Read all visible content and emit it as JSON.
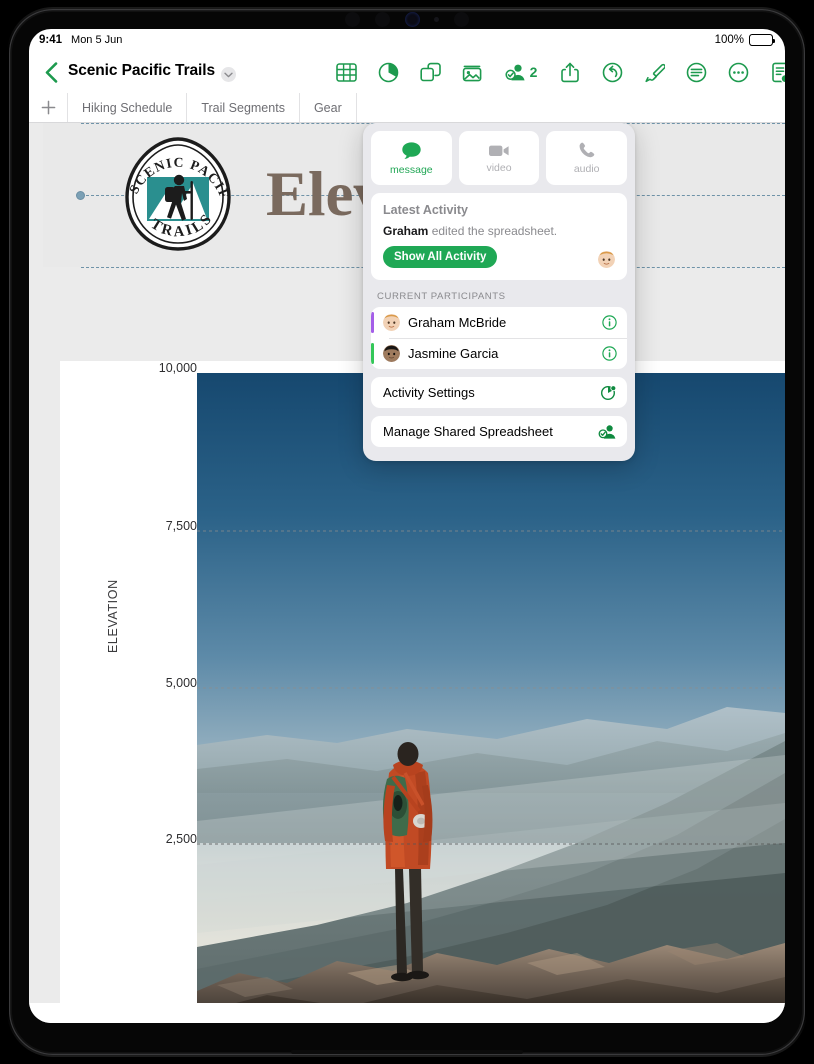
{
  "status_bar": {
    "time": "9:41",
    "date": "Mon 5 Jun",
    "battery_percent": "100%"
  },
  "navbar": {
    "back_icon": "chevron-left-icon",
    "document_title": "Scenic Pacific Trails",
    "title_chevron_icon": "chevron-down-icon",
    "tools": [
      {
        "name": "insert-table",
        "icon": "table-icon"
      },
      {
        "name": "insert-chart",
        "icon": "pie-chart-icon"
      },
      {
        "name": "insert-shape",
        "icon": "shapes-icon"
      },
      {
        "name": "insert-media",
        "icon": "photo-icon"
      },
      {
        "name": "collaborate",
        "icon": "collaborate-person-icon",
        "badge": "2"
      },
      {
        "name": "share",
        "icon": "share-up-arrow-icon"
      },
      {
        "name": "undo",
        "icon": "undo-arrow-icon"
      },
      {
        "name": "format",
        "icon": "paintbrush-icon"
      },
      {
        "name": "document-options",
        "icon": "lines-circle-icon"
      },
      {
        "name": "more",
        "icon": "ellipsis-circle-icon"
      },
      {
        "name": "document-collaboration",
        "icon": "document-badge-icon"
      }
    ]
  },
  "sheet_tabs": {
    "add_icon": "plus-icon",
    "tabs": [
      {
        "label": "Hiking Schedule"
      },
      {
        "label": "Trail Segments"
      },
      {
        "label": "Gear"
      }
    ]
  },
  "sheet": {
    "logo": {
      "top_arc_left": "SCENIC",
      "top_arc_right": "PACIFIC",
      "bottom_text": "TRAILS",
      "badge_color": "#2a8f8f"
    },
    "heading": "Elev",
    "selection_handle": "resize-handle"
  },
  "chart_data": {
    "type": "area",
    "title": "Elevation",
    "ylabel": "ELEVATION",
    "xlabel": "",
    "yticks": [
      "10,000",
      "7,500",
      "5,000",
      "2,500"
    ],
    "ytick_values": [
      10000,
      7500,
      5000,
      2500
    ],
    "ylim": [
      0,
      10000
    ],
    "grid": true,
    "legend": "none",
    "fill_image": "mountain-hiker-photo"
  },
  "popover": {
    "actions": [
      {
        "label": "message",
        "icon": "message-bubble-icon",
        "active": true
      },
      {
        "label": "video",
        "icon": "video-camera-icon",
        "active": false
      },
      {
        "label": "audio",
        "icon": "phone-handset-icon",
        "active": false
      }
    ],
    "latest_activity": {
      "title": "Latest Activity",
      "actor": "Graham",
      "text": " edited the spreadsheet.",
      "button_label": "Show All Activity",
      "avatar": "graham-avatar"
    },
    "participants_header": "CURRENT PARTICIPANTS",
    "participants": [
      {
        "name": "Graham McBride",
        "color": "#a45ee8",
        "avatar": "graham-avatar",
        "info_icon": "info-circle-icon"
      },
      {
        "name": "Jasmine Garcia",
        "color": "#34c759",
        "avatar": "jasmine-avatar",
        "info_icon": "info-circle-icon"
      }
    ],
    "rows": [
      {
        "label": "Activity Settings",
        "icon": "activity-settings-icon"
      },
      {
        "label": "Manage Shared Spreadsheet",
        "icon": "manage-share-icon"
      }
    ]
  },
  "colors": {
    "accent_green": "#1d9a4e",
    "button_green": "#1fa855",
    "heading_brown": "#7a6a5e",
    "selection_blue": "#7ba0b5"
  }
}
